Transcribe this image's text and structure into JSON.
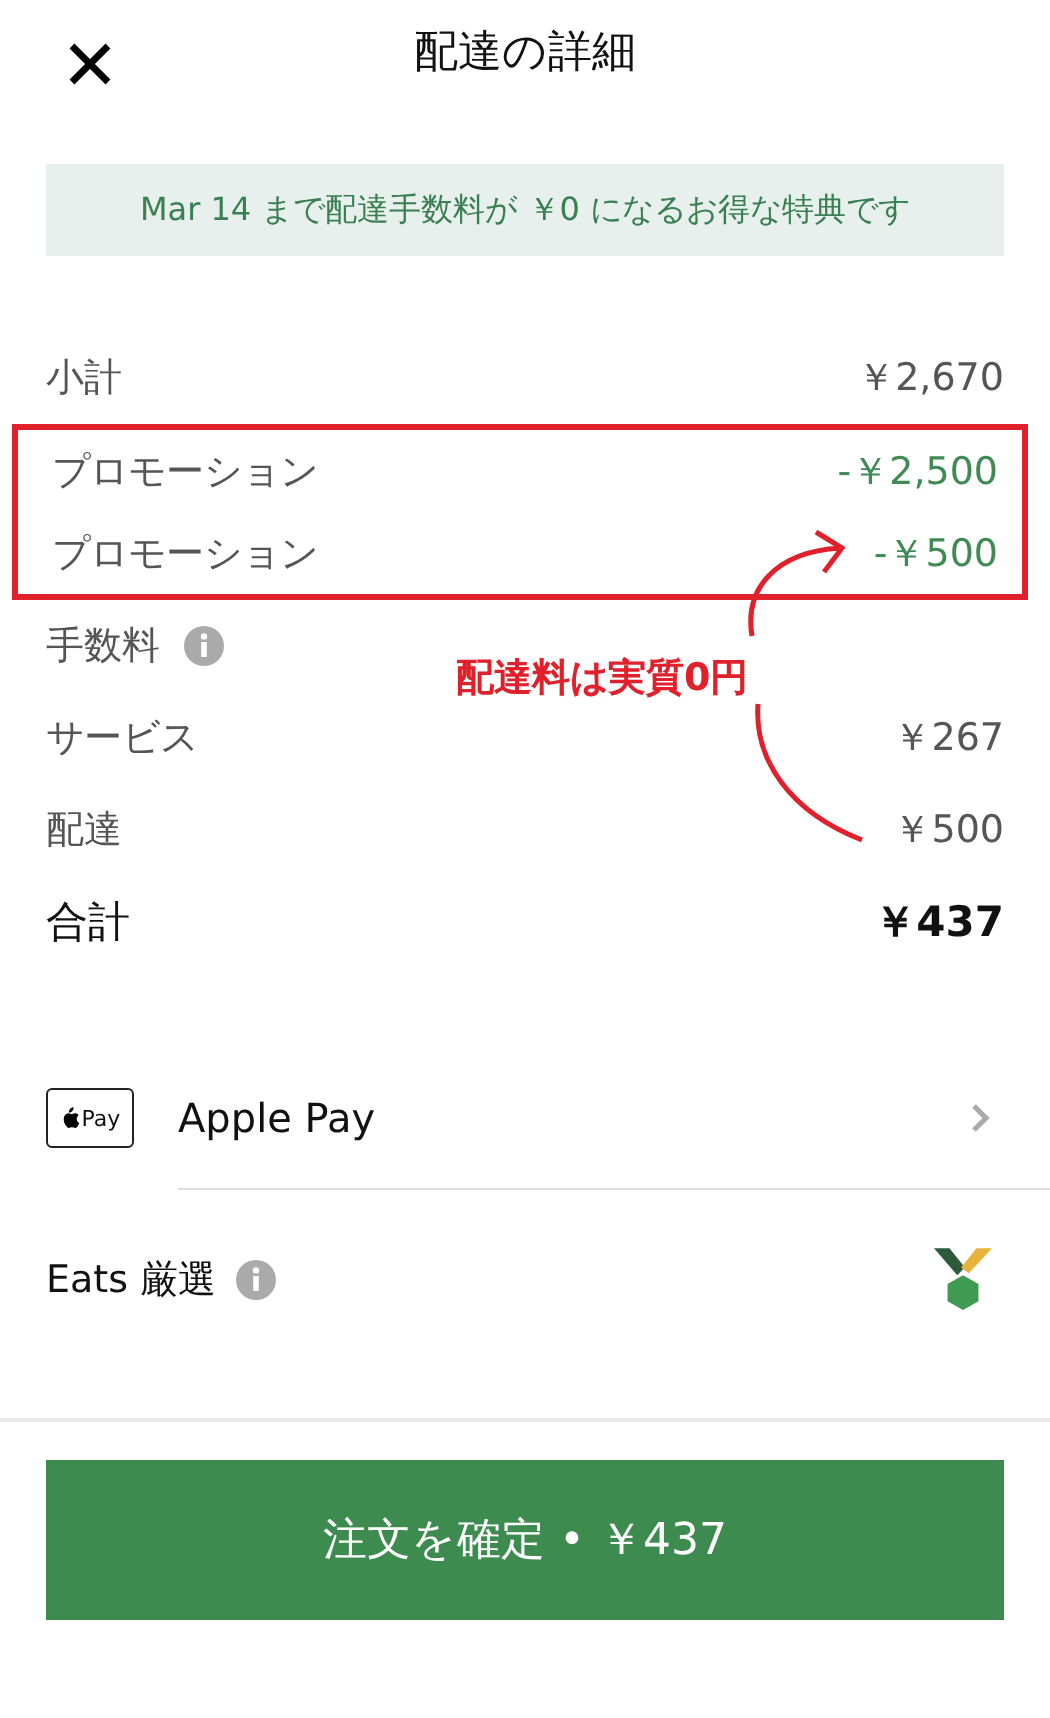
{
  "header": {
    "title": "配達の詳細"
  },
  "banner": {
    "text": "Mar 14 まで配達手数料が ￥0 になるお得な特典です"
  },
  "summary": {
    "subtotal": {
      "label": "小計",
      "value": "￥2,670"
    },
    "promotions": {
      "highlighted": true,
      "rows": [
        {
          "label": "プロモーション",
          "value": "-￥2,500"
        },
        {
          "label": "プロモーション",
          "value": "-￥500"
        }
      ]
    },
    "fees": {
      "label": "手数料",
      "rows": [
        {
          "label": "サービス",
          "value": "￥267"
        },
        {
          "label": "配達",
          "value": "￥500"
        }
      ]
    },
    "total": {
      "label": "合計",
      "value": "￥437"
    }
  },
  "annotation": {
    "text": "配達料は実質0円"
  },
  "payment": {
    "badge": "Pay",
    "label": "Apple Pay"
  },
  "eats": {
    "label": "Eats 厳選"
  },
  "confirm_button": {
    "label": "注文を確定 • ￥437"
  }
}
